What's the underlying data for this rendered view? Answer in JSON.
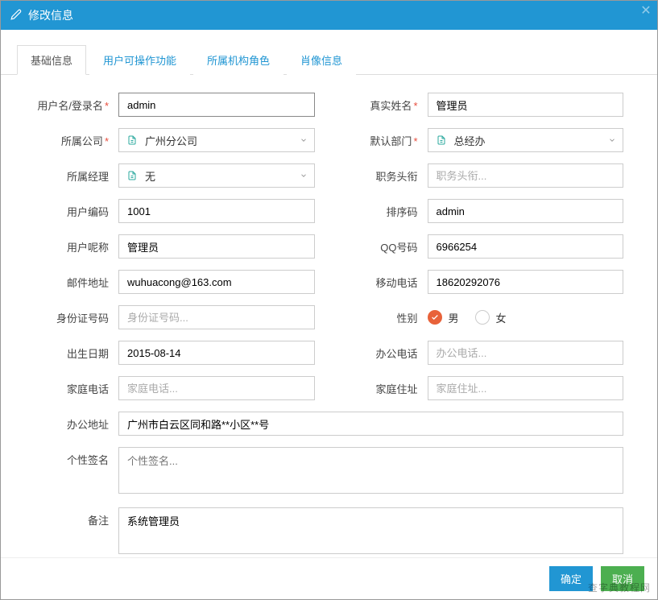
{
  "header": {
    "title": "修改信息"
  },
  "tabs": [
    {
      "label": "基础信息",
      "active": true
    },
    {
      "label": "用户可操作功能",
      "active": false
    },
    {
      "label": "所属机构角色",
      "active": false
    },
    {
      "label": "肖像信息",
      "active": false
    }
  ],
  "fields": {
    "username": {
      "label": "用户名/登录名",
      "value": "admin",
      "required": true
    },
    "realname": {
      "label": "真实姓名",
      "value": "管理员",
      "required": true
    },
    "company": {
      "label": "所属公司",
      "value": "广州分公司",
      "required": true
    },
    "department": {
      "label": "默认部门",
      "value": "总经办",
      "required": true
    },
    "manager": {
      "label": "所属经理",
      "value": "无"
    },
    "jobtitle": {
      "label": "职务头衔",
      "placeholder": "职务头衔..."
    },
    "usercode": {
      "label": "用户编码",
      "value": "1001"
    },
    "sortcode": {
      "label": "排序码",
      "value": "admin"
    },
    "nickname": {
      "label": "用户呢称",
      "value": "管理员"
    },
    "qq": {
      "label": "QQ号码",
      "value": "6966254"
    },
    "email": {
      "label": "邮件地址",
      "value": "wuhuacong@163.com"
    },
    "mobile": {
      "label": "移动电话",
      "value": "18620292076"
    },
    "idcard": {
      "label": "身份证号码",
      "placeholder": "身份证号码..."
    },
    "gender": {
      "label": "性别",
      "option_male": "男",
      "option_female": "女"
    },
    "birthdate": {
      "label": "出生日期",
      "value": "2015-08-14"
    },
    "officephone": {
      "label": "办公电话",
      "placeholder": "办公电话..."
    },
    "homephone": {
      "label": "家庭电话",
      "placeholder": "家庭电话..."
    },
    "homeaddress": {
      "label": "家庭住址",
      "placeholder": "家庭住址..."
    },
    "officeaddress": {
      "label": "办公地址",
      "value": "广州市白云区同和路**小区**号"
    },
    "signature": {
      "label": "个性签名",
      "placeholder": "个性签名..."
    },
    "remark": {
      "label": "备注",
      "value": "系统管理员"
    }
  },
  "buttons": {
    "confirm": "确定",
    "cancel": "取消"
  },
  "watermark": "查字典教程网"
}
